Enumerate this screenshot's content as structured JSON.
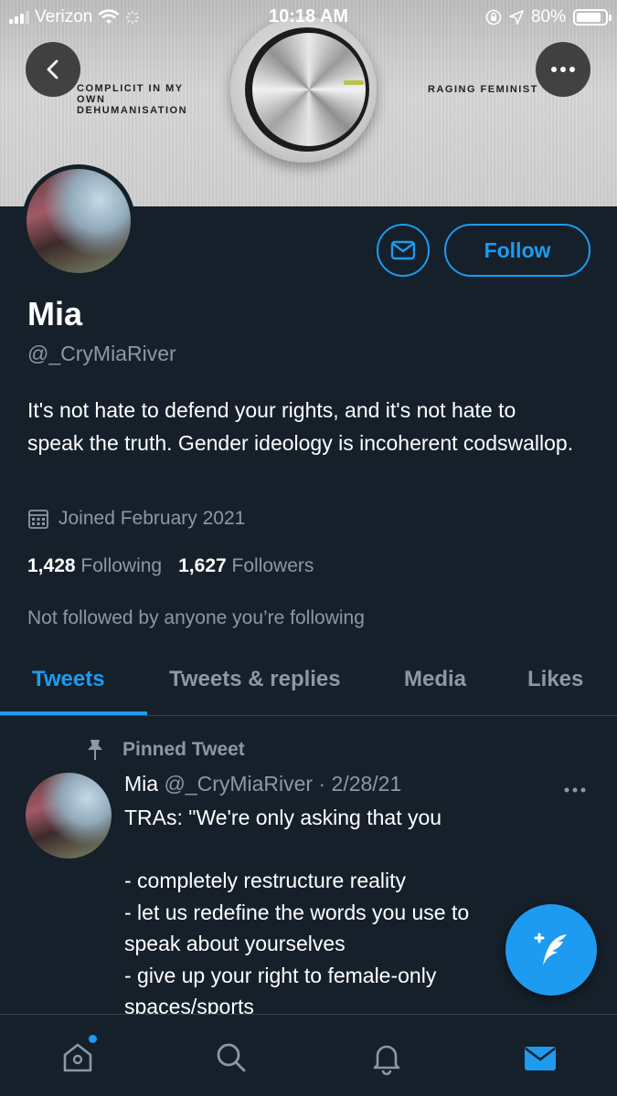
{
  "status_bar": {
    "carrier": "Verizon",
    "time": "10:18 AM",
    "battery": "80%",
    "battery_level": 0.8
  },
  "banner": {
    "left_text": "COMPLICIT IN MY OWN DEHUMANISATION",
    "right_text": "RAGING FEMINIST"
  },
  "profile": {
    "name": "Mia",
    "handle": "@_CryMiaRiver",
    "bio": "It's not hate to defend your rights, and it's not hate to speak the truth. Gender ideology is incoherent codswallop.",
    "joined": "Joined February 2021",
    "following_count": "1,428",
    "following_label": "Following",
    "followers_count": "1,627",
    "followers_label": "Followers",
    "not_followed": "Not followed by anyone you’re following",
    "follow_label": "Follow"
  },
  "tabs": [
    {
      "label": "Tweets",
      "active": true
    },
    {
      "label": "Tweets & replies",
      "active": false
    },
    {
      "label": "Media",
      "active": false
    },
    {
      "label": "Likes",
      "active": false
    }
  ],
  "tweet": {
    "pinned_label": "Pinned Tweet",
    "author": "Mia",
    "meta": "@_CryMiaRiver · 2/28/21",
    "lines": [
      "TRAs: \"We're only asking that you",
      "",
      "- completely restructure reality",
      "- let us redefine the words you use to",
      "speak about yourselves",
      "- give up your right to female-only",
      "spaces/sports"
    ]
  },
  "icons": {
    "back": "chevron-left-icon",
    "more": "ellipsis-icon",
    "mail": "envelope-icon",
    "calendar": "calendar-icon",
    "pin": "pin-icon",
    "compose": "compose-feather-icon",
    "nav": [
      "home-icon",
      "search-icon",
      "bell-icon",
      "mail-icon"
    ]
  },
  "colors": {
    "background": "#15202b",
    "accent": "#1d9bf0",
    "muted": "#8b98a5",
    "divider": "#38444d"
  }
}
